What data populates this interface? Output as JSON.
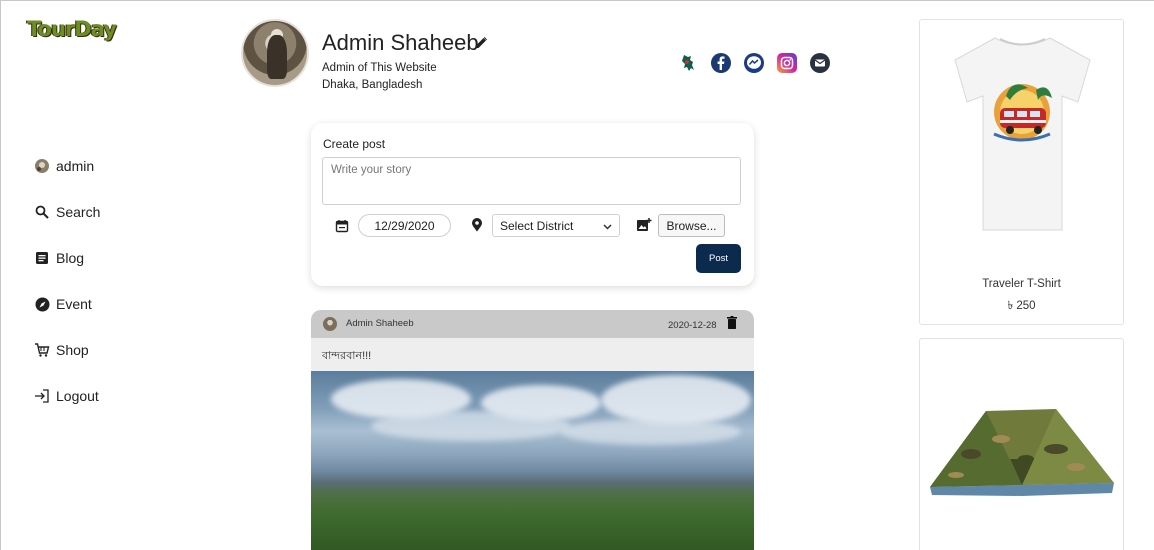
{
  "brand": {
    "logo_text": "TourDay"
  },
  "sidebar": {
    "items": [
      {
        "label": "admin",
        "icon": "user-avatar-icon"
      },
      {
        "label": "Search",
        "icon": "search-icon"
      },
      {
        "label": "Blog",
        "icon": "blog-icon"
      },
      {
        "label": "Event",
        "icon": "compass-icon"
      },
      {
        "label": "Shop",
        "icon": "cart-icon"
      },
      {
        "label": "Logout",
        "icon": "logout-icon"
      }
    ]
  },
  "profile": {
    "name": "Admin Shaheeb",
    "role": "Admin of This Website",
    "location": "Dhaka, Bangladesh",
    "social_icons": [
      "bangladesh-map-icon",
      "facebook-icon",
      "messenger-icon",
      "instagram-icon",
      "email-icon"
    ]
  },
  "create_post": {
    "title": "Create post",
    "story_placeholder": "Write your story",
    "date_value": "12/29/2020",
    "district_selected": "Select District",
    "browse_label": "Browse...",
    "post_label": "Post"
  },
  "feed": {
    "posts": [
      {
        "author": "Admin Shaheeb",
        "date": "2020-12-28",
        "text": "বান্দরবান!!!"
      }
    ]
  },
  "shop": {
    "products": [
      {
        "name": "Traveler T-Shirt",
        "price": "৳ 250"
      },
      {
        "name": "",
        "price": ""
      }
    ]
  },
  "colors": {
    "accent_button": "#0c2a4d",
    "post_header": "#c9c9c9"
  }
}
